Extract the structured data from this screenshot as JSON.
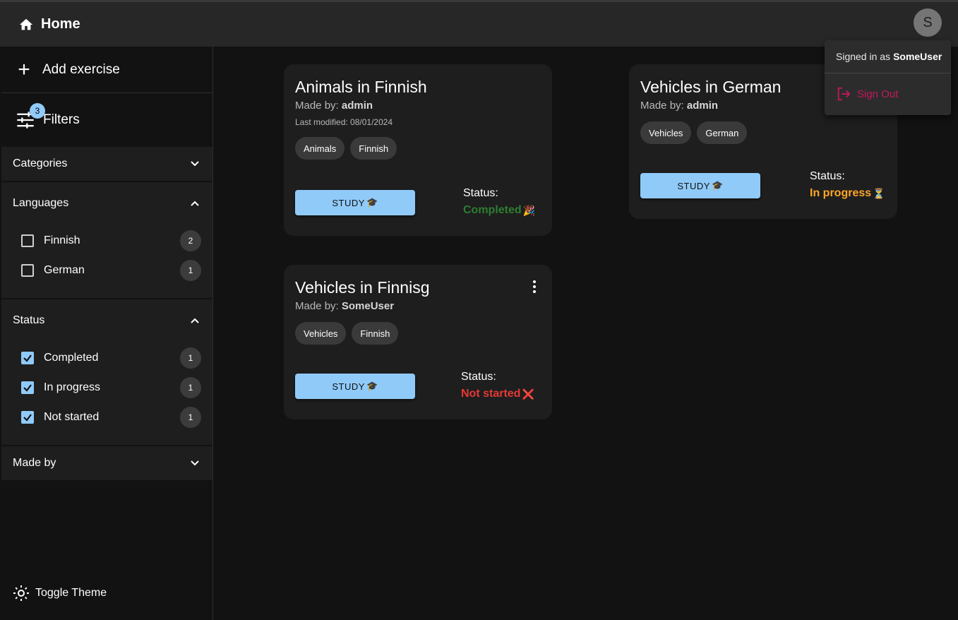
{
  "header": {
    "home_label": "Home",
    "avatar_letter": "S"
  },
  "sidebar": {
    "add_exercise_label": "Add exercise",
    "filters_label": "Filters",
    "filters_badge": "3",
    "sections": [
      {
        "title": "Categories"
      },
      {
        "title": "Languages",
        "items": [
          {
            "label": "Finnish",
            "count": "2",
            "checked": false
          },
          {
            "label": "German",
            "count": "1",
            "checked": false
          }
        ]
      },
      {
        "title": "Status",
        "items": [
          {
            "label": "Completed",
            "count": "1",
            "checked": true
          },
          {
            "label": "In progress",
            "count": "1",
            "checked": true
          },
          {
            "label": "Not started",
            "count": "1",
            "checked": true
          }
        ]
      },
      {
        "title": "Made by"
      }
    ],
    "toggle_theme_label": "Toggle Theme"
  },
  "cards": [
    {
      "title": "Animals in Finnish",
      "made_by_prefix": "Made by:",
      "made_by": "admin",
      "last_modified": "Last modified: 08/01/2024",
      "tags": [
        "Animals",
        "Finnish"
      ],
      "study_label": "STUDY",
      "status_label": "Status:",
      "status_value": "Completed",
      "status_emoji": "🎉"
    },
    {
      "title": "Vehicles in German",
      "made_by_prefix": "Made by:",
      "made_by": "admin",
      "tags": [
        "Vehicles",
        "German"
      ],
      "study_label": "STUDY",
      "status_label": "Status:",
      "status_value": "In progress",
      "status_emoji": "⏳"
    },
    {
      "title": "Vehicles in Finnisg",
      "made_by_prefix": "Made by:",
      "made_by": "SomeUser",
      "tags": [
        "Vehicles",
        "Finnish"
      ],
      "study_label": "STUDY",
      "status_label": "Status:",
      "status_value": "Not started",
      "status_emoji": "❌"
    }
  ],
  "study_emoji": "🎓",
  "user_menu": {
    "signed_in_prefix": "Signed in as",
    "username": "SomeUser",
    "sign_out_label": "Sign Out"
  },
  "colors": {
    "completed": "#2e7d32",
    "in_progress": "#ffa726",
    "not_started": "#e53935",
    "accent": "#90caf9",
    "sign_out": "#c2185b"
  }
}
